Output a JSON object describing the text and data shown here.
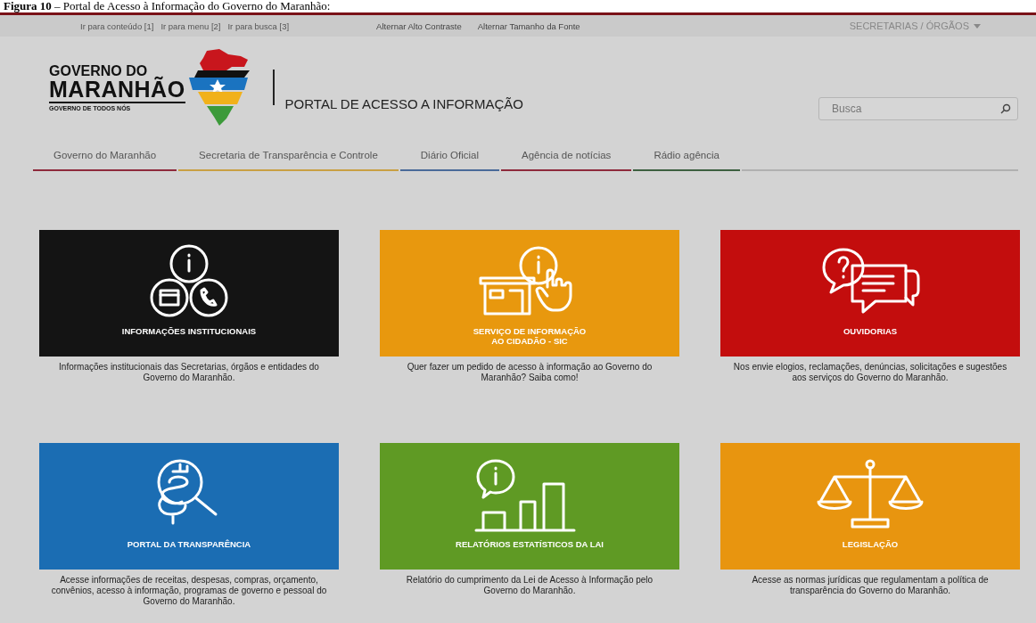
{
  "caption": "**Figura 10** – Portal de Acesso à Informação do Governo do Maranhão:",
  "top_bar": {
    "skip_links": [
      "Ir para conteúdo [1]",
      "Ir para menu [2]",
      "Ir para busca [3]"
    ],
    "accessibility_links": [
      "Alternar Alto Contraste",
      "Alternar Tamanho da Fonte"
    ],
    "dropdown": "SECRETARIAS / ÓRGÃOS"
  },
  "logo": {
    "line_1": "GOVERNO DO",
    "line_2": "MARANHÃO",
    "slogan": "GOVERNO DE TODOS NÓS"
  },
  "portal_title": "PORTAL DE ACESSO A INFORMAÇÃO",
  "search": {
    "placeholder": "Busca"
  },
  "nav": [
    {
      "label": "Governo do Maranhão",
      "color": "#8e2a3c"
    },
    {
      "label": "Secretaria de Transparência e Controle",
      "color": "#c9a043"
    },
    {
      "label": "Diário Oficial",
      "color": "#4a6a99"
    },
    {
      "label": "Agência de notícias",
      "color": "#8e2a3c"
    },
    {
      "label": "Rádio agência",
      "color": "#3d6040"
    }
  ],
  "cards": [
    {
      "kind": "institutional",
      "color": "#141414",
      "title": "INFORMAÇÕES INSTITUCIONAIS",
      "description": "Informações institucionais das Secretarias, órgãos e entidades do Governo do Maranhão."
    },
    {
      "kind": "service",
      "color": "#e8980e",
      "title": "SERVIÇO DE INFORMAÇÃO\nAO CIDADÃO - SIC",
      "description": "Quer fazer um pedido de acesso à informação ao Governo do Maranhão? Saiba como!"
    },
    {
      "kind": "ombudsman",
      "color": "#c30d0d",
      "title": "OUVIDORIAS",
      "description": "Nos envie elogios, reclamações, denúncias, solicitações e sugestões aos serviços do Governo do Maranhão."
    },
    {
      "kind": "transparency",
      "color": "#1b6db3",
      "title": "PORTAL DA TRANSPARÊNCIA",
      "description": "Acesse informações de receitas, despesas, compras, orçamento, convênios, acesso à informação, programas de governo e pessoal do Governo do Maranhão."
    },
    {
      "kind": "reports",
      "color": "#5f9a24",
      "title": "RELATÓRIOS ESTATÍSTICOS DA LAI",
      "description": "Relatório do cumprimento da Lei de Acesso à Informação pelo Governo do Maranhão."
    },
    {
      "kind": "legislation",
      "color": "#e8950f",
      "title": "LEGISLAÇÃO",
      "description": "Acesse as normas jurídicas que regulamentam a política de transparência do Governo do Maranhão."
    }
  ]
}
